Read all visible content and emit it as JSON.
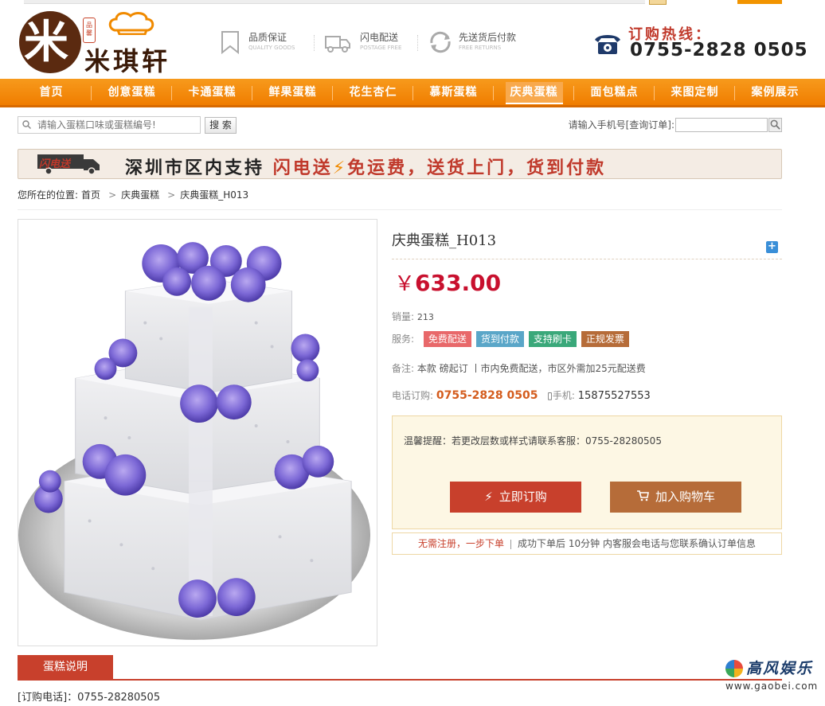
{
  "brand": {
    "logo_char": "米",
    "seal": "品馨",
    "name": "米琪轩"
  },
  "features": [
    {
      "icon": "bookmark-icon",
      "title": "品质保证",
      "sub": "QUALITY GOODS"
    },
    {
      "icon": "truck-icon",
      "title": "闪电配送",
      "sub": "POSTAGE FREE"
    },
    {
      "icon": "return-icon",
      "title": "先送货后付款",
      "sub": "FREE RETURNS"
    }
  ],
  "hotline": {
    "label": "订购热线：",
    "number": "0755-2828 0505"
  },
  "nav": {
    "items": [
      "首页",
      "创意蛋糕",
      "卡通蛋糕",
      "鲜果蛋糕",
      "花生杏仁",
      "慕斯蛋糕",
      "庆典蛋糕",
      "面包糕点",
      "来图定制",
      "案例展示"
    ],
    "active_index": 6
  },
  "search": {
    "placeholder": "请输入蛋糕口味或蛋糕编号!",
    "button": "搜 索",
    "order_query_label": "请输入手机号[查询订单]:"
  },
  "banner": {
    "badge": "闪电送",
    "text1": "深圳市区内支持",
    "text2": "闪电送",
    "bolt": "⚡",
    "text3": "免运费，送货上门，货到付款"
  },
  "breadcrumb": {
    "prefix": "您所在的位置:",
    "items": [
      "首页",
      "庆典蛋糕",
      "庆典蛋糕_H013"
    ]
  },
  "product": {
    "title": "庆典蛋糕_H013",
    "currency": "￥",
    "price": "633.00",
    "sales_label": "销量:",
    "sales": "213",
    "service_label": "服务:",
    "services": [
      {
        "label": "免费配送",
        "color": "#e8686a"
      },
      {
        "label": "货到付款",
        "color": "#5aa6c8"
      },
      {
        "label": "支持刷卡",
        "color": "#3aa87a"
      },
      {
        "label": "正规发票",
        "color": "#b66c39"
      }
    ],
    "note_label": "备注:",
    "note": "本款 磅起订 丨市内免费配送，市区外需加25元配送费",
    "phone_label": "电话订购:",
    "phone": "0755-2828 0505",
    "mobile_label": "手机:",
    "mobile": "15875527553"
  },
  "remind": {
    "text": "温馨提醒：若更改层数或样式请联系客服：0755-28280505",
    "buy": "立即订购",
    "cart": "加入购物车"
  },
  "quick": {
    "a": "无需注册，一步下单",
    "b": "成功下单后 10分钟 内客服会电话与您联系确认订单信息"
  },
  "tabs": {
    "desc": "蛋糕说明"
  },
  "order_phone": "[订购电话]：0755-28280505",
  "watermark": {
    "title": "高风娱乐",
    "url": "www.gaobei.com"
  }
}
